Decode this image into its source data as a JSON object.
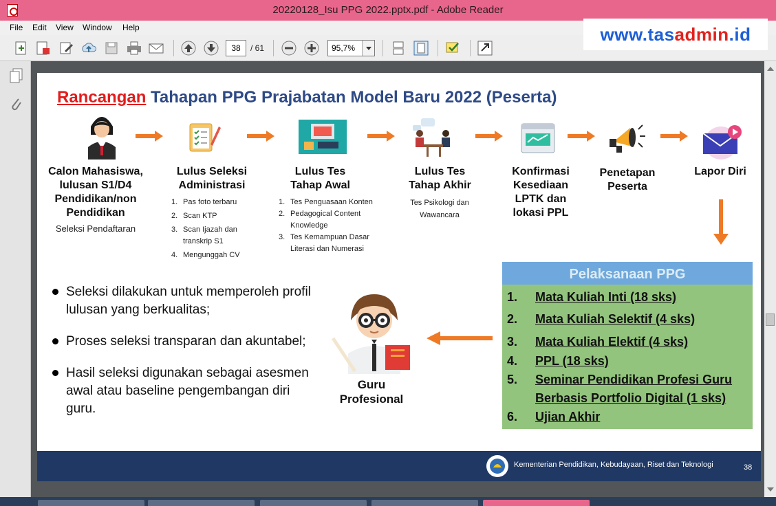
{
  "window": {
    "title": "20220128_Isu PPG 2022.pptx.pdf - Adobe Reader"
  },
  "menu": [
    "File",
    "Edit",
    "View",
    "Window",
    "Help"
  ],
  "toolbar": {
    "page_current": "38",
    "page_total": "/ 61",
    "zoom": "95,7%"
  },
  "watermark": {
    "part1": "www.",
    "part2": "tas",
    "part3": "admin",
    "part4": ".id"
  },
  "slide": {
    "title_red": "Rancangan",
    "title_rest": " Tahapan PPG Prajabatan Model Baru 2022 (Peserta)",
    "steps": [
      {
        "title": "Calon Mahasiswa, lulusan S1/D4 Pendidikan/non Pendidikan",
        "sub": "Seleksi Pendaftaran"
      },
      {
        "title": "Lulus Seleksi Administrasi",
        "items": [
          "Pas foto terbaru",
          "Scan KTP",
          "Scan Ijazah dan transkrip S1",
          "Mengunggah CV"
        ]
      },
      {
        "title": "Lulus Tes Tahap Awal",
        "items": [
          "Tes Penguasaan Konten",
          "Pedagogical Content Knowledge",
          "Tes Kemampuan Dasar Literasi dan Numerasi"
        ]
      },
      {
        "title": "Lulus Tes Tahap Akhir",
        "note": "Tes Psikologi dan Wawancara"
      },
      {
        "title": "Konfirmasi Kesediaan LPTK dan lokasi PPL"
      },
      {
        "title": "Penetapan Peserta"
      },
      {
        "title": "Lapor Diri"
      }
    ],
    "bullets": [
      "Seleksi dilakukan untuk memperoleh profil lulusan yang berkualitas;",
      "Proses seleksi transparan dan akuntabel;",
      "Hasil seleksi digunakan sebagai asesmen awal atau baseline pengembangan diri guru."
    ],
    "guru_label": "Guru Profesional",
    "ppg": {
      "heading": "Pelaksanaan PPG",
      "items": [
        {
          "num": "1.",
          "text": "Mata Kuliah Inti (18 sks)"
        },
        {
          "num": "2.",
          "text": "Mata Kuliah Selektif (4 sks)"
        },
        {
          "num": "3.",
          "text": "Mata Kuliah Elektif (4 sks)"
        },
        {
          "num": "4.",
          "text": "PPL (18 sks)"
        },
        {
          "num": "5.",
          "text": "Seminar Pendidikan Profesi Guru"
        },
        {
          "num": "",
          "text": "Berbasis Portfolio Digital (1 sks)"
        },
        {
          "num": "6.",
          "text": "Ujian Akhir"
        }
      ]
    },
    "footer": {
      "ministry": "Kementerian Pendidikan, Kebudayaan, Riset dan Teknologi",
      "page_number": "38"
    }
  }
}
